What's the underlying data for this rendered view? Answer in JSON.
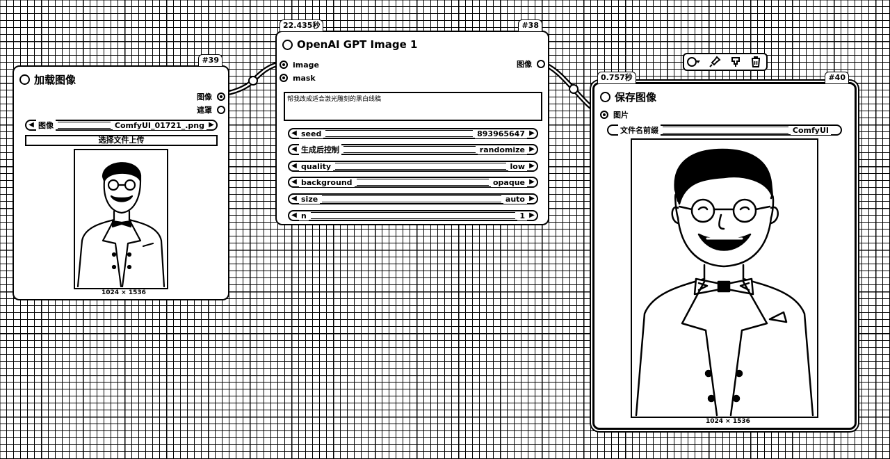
{
  "links": {
    "color": "#000000"
  },
  "toolbar": {
    "icons": [
      "color-toggle-icon",
      "pin-icon",
      "bypass-icon",
      "delete-icon"
    ]
  },
  "node39": {
    "id": "#39",
    "title": "加载图像",
    "outputs": [
      "图像",
      "遮罩"
    ],
    "image_widget": {
      "name": "图像",
      "value": "ComfyUI_01721_.png"
    },
    "upload_label": "选择文件上传",
    "image_size": "1024 × 1536"
  },
  "node38": {
    "id": "#38",
    "time": "22.435秒",
    "title": "OpenAI GPT Image 1",
    "inputs": [
      "image",
      "mask"
    ],
    "output": "图像",
    "prompt": "帮我改成适合激光雕刻的黑白线稿",
    "widgets": [
      {
        "name": "seed",
        "value": "893965647"
      },
      {
        "name": "生成后控制",
        "value": "randomize"
      },
      {
        "name": "quality",
        "value": "low"
      },
      {
        "name": "background",
        "value": "opaque"
      },
      {
        "name": "size",
        "value": "auto"
      },
      {
        "name": "n",
        "value": "1"
      }
    ]
  },
  "node40": {
    "id": "#40",
    "time": "0.757秒",
    "title": "保存图像",
    "input": "图片",
    "prefix_widget": {
      "name": "文件名前缀",
      "value": "ComfyUI"
    },
    "image_size": "1024 × 1536"
  }
}
